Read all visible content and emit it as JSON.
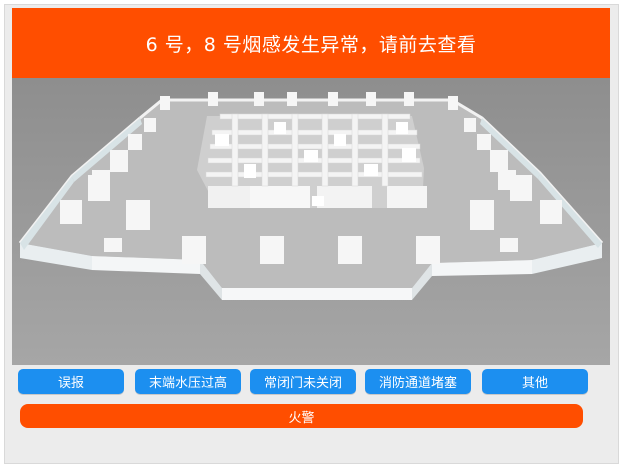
{
  "alert": {
    "message": "6 号，8 号烟感发生异常，请前去查看"
  },
  "floor_view": {
    "image": "3d-floor-plan"
  },
  "actions": {
    "buttons": [
      {
        "label": "误报"
      },
      {
        "label": "末端水压过高"
      },
      {
        "label": "常闭门未关闭"
      },
      {
        "label": "消防通道堵塞"
      },
      {
        "label": "其他"
      }
    ],
    "fire_alarm": {
      "label": "火警"
    }
  },
  "colors": {
    "alert": "#ff4e00",
    "button": "#1c8ff0",
    "fire": "#ff4e00"
  }
}
